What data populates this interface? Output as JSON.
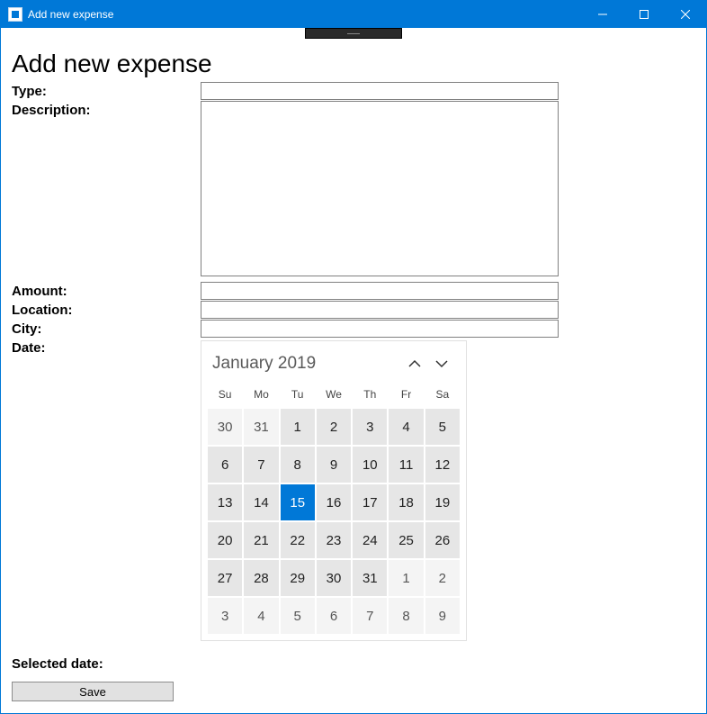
{
  "titlebar": {
    "title": "Add new expense"
  },
  "page": {
    "heading": "Add new expense"
  },
  "form": {
    "type_label": "Type:",
    "type_value": "",
    "description_label": "Description:",
    "description_value": "",
    "amount_label": "Amount:",
    "amount_value": "",
    "location_label": "Location:",
    "location_value": "",
    "city_label": "City:",
    "city_value": "",
    "date_label": "Date:"
  },
  "calendar": {
    "title": "January 2019",
    "day_headers": [
      "Su",
      "Mo",
      "Tu",
      "We",
      "Th",
      "Fr",
      "Sa"
    ],
    "selected_day": 15,
    "rows": [
      [
        {
          "n": 30,
          "out": true
        },
        {
          "n": 31,
          "out": true
        },
        {
          "n": 1
        },
        {
          "n": 2
        },
        {
          "n": 3
        },
        {
          "n": 4
        },
        {
          "n": 5
        }
      ],
      [
        {
          "n": 6
        },
        {
          "n": 7
        },
        {
          "n": 8
        },
        {
          "n": 9
        },
        {
          "n": 10
        },
        {
          "n": 11
        },
        {
          "n": 12
        }
      ],
      [
        {
          "n": 13
        },
        {
          "n": 14
        },
        {
          "n": 15,
          "sel": true
        },
        {
          "n": 16
        },
        {
          "n": 17
        },
        {
          "n": 18
        },
        {
          "n": 19
        }
      ],
      [
        {
          "n": 20
        },
        {
          "n": 21
        },
        {
          "n": 22
        },
        {
          "n": 23
        },
        {
          "n": 24
        },
        {
          "n": 25
        },
        {
          "n": 26
        }
      ],
      [
        {
          "n": 27
        },
        {
          "n": 28
        },
        {
          "n": 29
        },
        {
          "n": 30
        },
        {
          "n": 31
        },
        {
          "n": 1,
          "out": true
        },
        {
          "n": 2,
          "out": true
        }
      ],
      [
        {
          "n": 3,
          "out": true
        },
        {
          "n": 4,
          "out": true
        },
        {
          "n": 5,
          "out": true
        },
        {
          "n": 6,
          "out": true
        },
        {
          "n": 7,
          "out": true
        },
        {
          "n": 8,
          "out": true
        },
        {
          "n": 9,
          "out": true
        }
      ]
    ]
  },
  "selected": {
    "label": "Selected date:",
    "value": ""
  },
  "buttons": {
    "save": "Save"
  }
}
